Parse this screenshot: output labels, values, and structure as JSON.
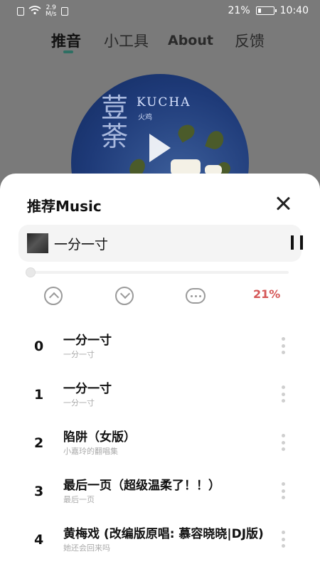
{
  "status_bar": {
    "network_speed": "2.9\nM/s",
    "network_speed_value": "2.9",
    "network_speed_unit": "M/s",
    "battery_percent": "21%",
    "battery_level": 0.21,
    "time": "10:40"
  },
  "tabs": [
    {
      "label": "推音",
      "active": true
    },
    {
      "label": "小工具",
      "active": false
    },
    {
      "label": "About",
      "active": false
    },
    {
      "label": "反馈",
      "active": false
    }
  ],
  "album_art": {
    "brand_text": "KUCHA",
    "sub_text": "火鸡",
    "big_text": "荳荼"
  },
  "sheet": {
    "title": "推荐Music",
    "now_playing": {
      "title": "一分一寸"
    },
    "progress": 0.0,
    "volume_label": "21%"
  },
  "songs": [
    {
      "index": "0",
      "name": "一分一寸",
      "artist": "一分一寸"
    },
    {
      "index": "1",
      "name": "一分一寸",
      "artist": "一分一寸"
    },
    {
      "index": "2",
      "name": "陷阱（女版）",
      "artist": "小嘉玲的翻唱集"
    },
    {
      "index": "3",
      "name": "最后一页（超级温柔了！！）",
      "artist": "最后一页"
    },
    {
      "index": "4",
      "name": "黄梅戏 (改编版原唱: 慕容晓晓|DJ版)",
      "artist": "她还会回来吗"
    }
  ],
  "colors": {
    "accent": "#2e6f63",
    "percent_red": "#d55757",
    "overlay": "#7a7a7a"
  }
}
